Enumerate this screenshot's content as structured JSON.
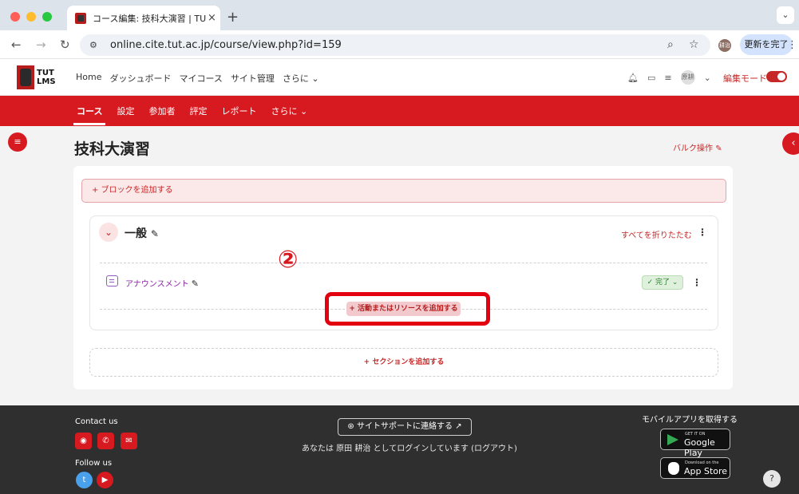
{
  "browser": {
    "tab_title": "コース編集: 技科大演習 | TUT LMS",
    "tab_close": "×",
    "new_tab": "+",
    "url": "online.cite.tut.ac.jp/course/view.php?id=159",
    "update_button": "更新を完了",
    "profile_initials": "耕治"
  },
  "header": {
    "logo_line1": "TUT",
    "logo_line2": "LMS",
    "nav": [
      "Home",
      "ダッシュボード",
      "マイコース",
      "サイト管理",
      "さらに ⌄"
    ],
    "user_avatar": "原耕",
    "user_chevron": "⌄",
    "edit_mode_label": "編集モード"
  },
  "course_nav": {
    "items": [
      "コース",
      "設定",
      "参加者",
      "評定",
      "レポート",
      "さらに ⌄"
    ]
  },
  "page": {
    "course_title": "技科大演習",
    "bulk_edit": "バルク操作",
    "add_block": "+ ブロックを追加する",
    "section_title": "一般",
    "collapse_all": "すべてを折りたたむ",
    "annotation_number": "②",
    "activity_name": "アナウンスメント",
    "completion_button": "✓ 完了 ⌄",
    "add_activity": "+ 活動またはリソースを追加する",
    "add_section": "+ セクションを追加する"
  },
  "footer": {
    "contact_title": "Contact us",
    "follow_title": "Follow us",
    "support_button": "サイトサポートに連絡する",
    "logged_in_text": "あなたは 原田 耕治 としてログインしています (ログアウト)",
    "mobile_app_title": "モバイルアプリを取得する",
    "google_play_small": "GET IT ON",
    "google_play_big": "Google Play",
    "app_store_small": "Download on the",
    "app_store_big": "App Store",
    "help": "?"
  },
  "colors": {
    "brand_red": "#d71920",
    "highlight_red": "#e3000f",
    "footer_bg": "#2f2f2f"
  }
}
